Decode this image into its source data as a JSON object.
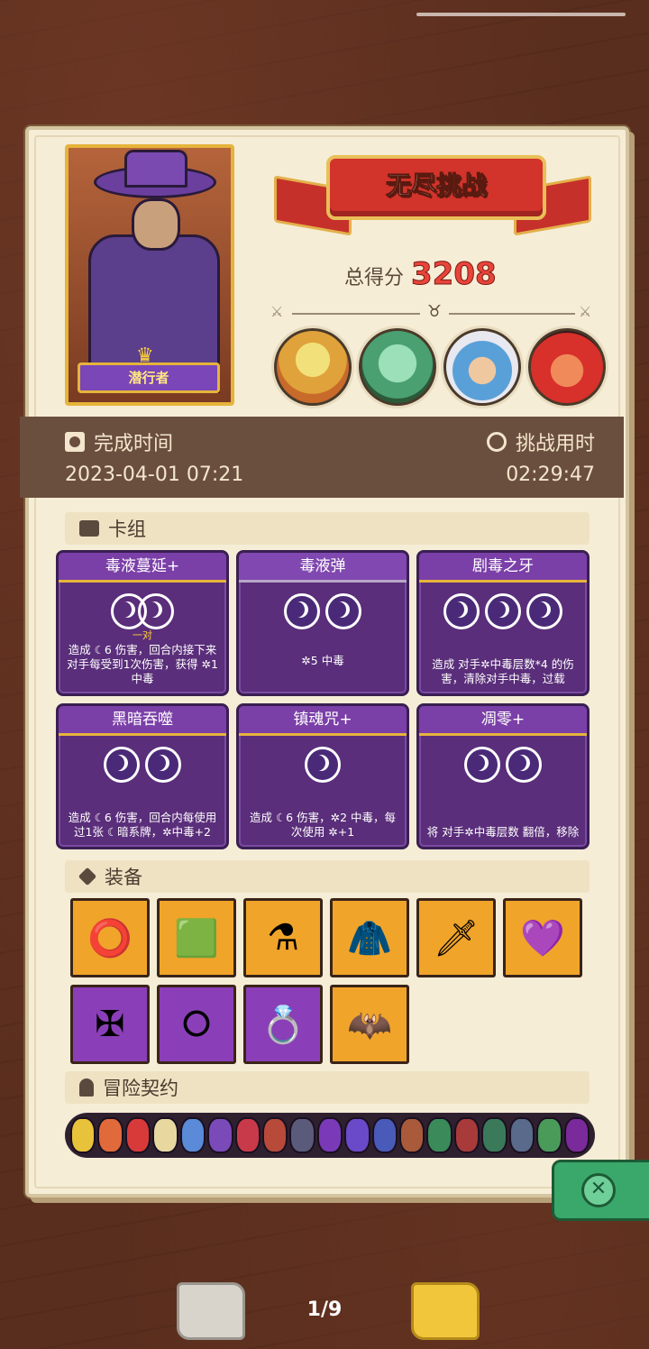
{
  "character": {
    "name": "潜行者"
  },
  "mode": {
    "title": "无尽挑战"
  },
  "score": {
    "label": "总得分",
    "value": "3208"
  },
  "completion": {
    "label": "完成时间",
    "value": "2023-04-01 07:21"
  },
  "duration": {
    "label": "挑战用时",
    "value": "02:29:47"
  },
  "deck": {
    "title": "卡组",
    "cards": [
      {
        "name": "毒液蔓延+",
        "orbs": 2,
        "orb_label": "一对",
        "desc": "造成 ☾6 伤害，回合内接下来对手每受到1次伤害，获得 ✲1 中毒"
      },
      {
        "name": "毒液弹",
        "orbs": 2,
        "orb_label": "",
        "desc": "✲5 中毒"
      },
      {
        "name": "剧毒之牙",
        "orbs": 3,
        "orb_label": "",
        "desc": "造成 对手✲中毒层数*4 的伤害，清除对手中毒，过载"
      },
      {
        "name": "黑暗吞噬",
        "orbs": 2,
        "orb_label": "",
        "desc": "造成 ☾6 伤害，回合内每使用过1张 ☾暗系牌，✲中毒+2"
      },
      {
        "name": "镇魂咒+",
        "orbs": 1,
        "orb_label": "",
        "desc": "造成 ☾6 伤害，✲2 中毒，每次使用 ✲+1"
      },
      {
        "name": "凋零+",
        "orbs": 2,
        "orb_label": "",
        "desc": "将 对手✲中毒层数 翻倍，移除"
      }
    ]
  },
  "equipment": {
    "title": "装备",
    "items": [
      {
        "icon": "ring-icon",
        "glyph": "⭕",
        "color": "orange"
      },
      {
        "icon": "moss-stone-icon",
        "glyph": "🟩",
        "color": "orange"
      },
      {
        "icon": "eye-flask-icon",
        "glyph": "⚗",
        "color": "orange"
      },
      {
        "icon": "sweater-icon",
        "glyph": "🧥",
        "color": "orange"
      },
      {
        "icon": "crystal-dagger-icon",
        "glyph": "🗡",
        "color": "orange"
      },
      {
        "icon": "cursed-heart-icon",
        "glyph": "💜",
        "color": "orange"
      },
      {
        "icon": "golden-knot-icon",
        "glyph": "✠",
        "color": "purple"
      },
      {
        "icon": "bracelet-icon",
        "glyph": "⭘",
        "color": "purple"
      },
      {
        "icon": "magic-ring-icon",
        "glyph": "💍",
        "color": "purple"
      },
      {
        "icon": "bat-cloak-icon",
        "glyph": "🦇",
        "color": "orange"
      }
    ]
  },
  "contracts": {
    "title": "冒险契约",
    "count": 19
  },
  "pagination": {
    "current": "1/9"
  },
  "colors": {
    "score": "#e8443a",
    "card_bg": "#5a2e7a",
    "time_band": "#6b4f3e",
    "close_button": "#3aa86a"
  }
}
